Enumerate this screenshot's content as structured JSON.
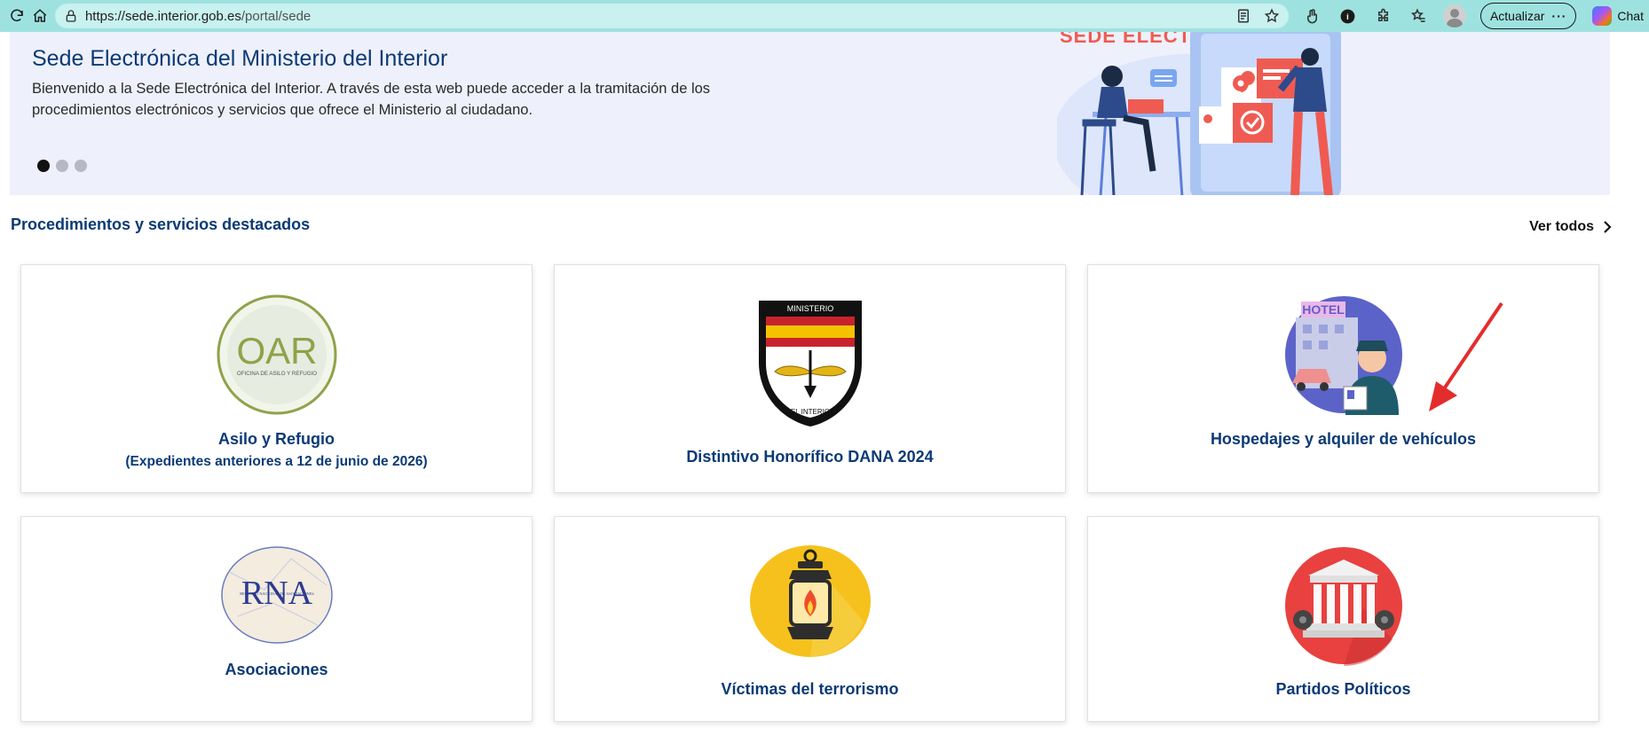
{
  "browser": {
    "url_host": "https://sede.interior.gob.es",
    "url_path": "/portal/sede",
    "update_label": "Actualizar",
    "chat_label": "Chat"
  },
  "banner": {
    "title": "Sede Electrónica del Ministerio del Interior",
    "text": "Bienvenido a la Sede Electrónica del Interior. A través de esta web puede acceder a la tramitación de los procedimientos electrónicos y servicios que ofrece el Ministerio al ciudadano.",
    "hero_title": "SEDE ELECTRÓNICA",
    "slides": 3,
    "active_slide": 1
  },
  "section": {
    "title": "Procedimientos y servicios destacados",
    "see_all": "Ver todos"
  },
  "cards": [
    {
      "title": "Asilo y Refugio",
      "subtitle": "(Expedientes anteriores a 12 de junio de 2026)",
      "logo_text": "OAR",
      "logo_subtext": "OFICINA DE ASILO Y REFUGIO"
    },
    {
      "title": "Distintivo Honorífico DANA 2024",
      "logo_top": "MINISTERIO",
      "logo_bottom": "DEL INTERIOR"
    },
    {
      "title": "Hospedajes y alquiler de vehículos",
      "logo_text": "HOTEL"
    },
    {
      "title": "Asociaciones",
      "logo_text": "RNA",
      "logo_subtext": "REGISTRO NACIONAL DE ASOCIACIONES"
    },
    {
      "title": "Víctimas del terrorismo"
    },
    {
      "title": "Partidos Políticos"
    }
  ],
  "colors": {
    "toolbar": "#9ee2e0",
    "brand_blue": "#0b3a75",
    "banner_bg": "#eef0fb",
    "accent_red": "#e32d2d"
  }
}
